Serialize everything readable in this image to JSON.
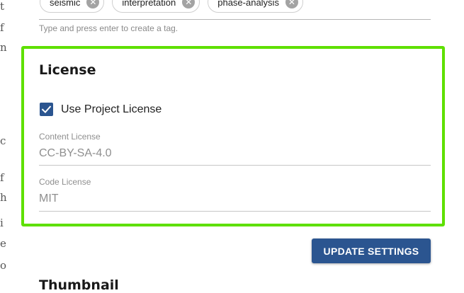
{
  "background_page": {
    "fragments": [
      "t",
      "f",
      "n",
      "c",
      "f",
      "h",
      "i",
      "e",
      "o"
    ]
  },
  "tags": {
    "chips": [
      {
        "label": "seismic"
      },
      {
        "label": "interpretation"
      },
      {
        "label": "phase-analysis"
      }
    ],
    "hint": "Type and press enter to create a tag."
  },
  "license": {
    "title": "License",
    "use_project_license": {
      "label": "Use Project License",
      "checked": true
    },
    "content_license": {
      "label": "Content License",
      "value": "CC-BY-SA-4.0"
    },
    "code_license": {
      "label": "Code License",
      "value": "MIT"
    }
  },
  "actions": {
    "update_label": "UPDATE SETTINGS"
  },
  "thumbnail": {
    "title": "Thumbnail"
  },
  "colors": {
    "primary": "#2b5590",
    "highlight": "#5ee000"
  }
}
